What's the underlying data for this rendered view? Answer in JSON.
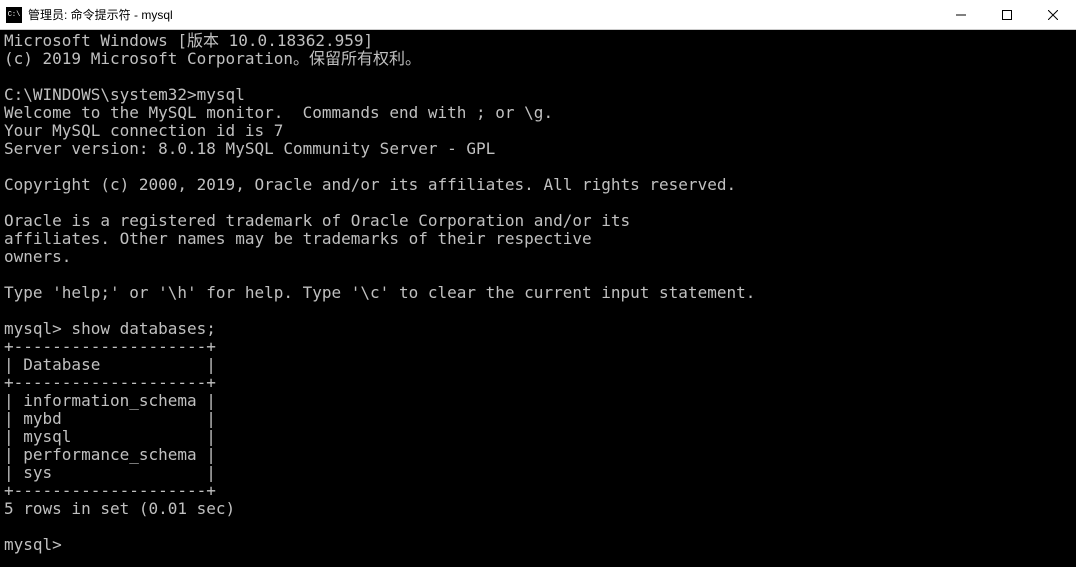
{
  "window": {
    "title": "管理员: 命令提示符 - mysql"
  },
  "terminal": {
    "lines": [
      "Microsoft Windows [版本 10.0.18362.959]",
      "(c) 2019 Microsoft Corporation。保留所有权利。",
      "",
      "C:\\WINDOWS\\system32>mysql",
      "Welcome to the MySQL monitor.  Commands end with ; or \\g.",
      "Your MySQL connection id is 7",
      "Server version: 8.0.18 MySQL Community Server - GPL",
      "",
      "Copyright (c) 2000, 2019, Oracle and/or its affiliates. All rights reserved.",
      "",
      "Oracle is a registered trademark of Oracle Corporation and/or its",
      "affiliates. Other names may be trademarks of their respective",
      "owners.",
      "",
      "Type 'help;' or '\\h' for help. Type '\\c' to clear the current input statement.",
      "",
      "mysql> show databases;",
      "+--------------------+",
      "| Database           |",
      "+--------------------+",
      "| information_schema |",
      "| mybd               |",
      "| mysql              |",
      "| performance_schema |",
      "| sys                |",
      "+--------------------+",
      "5 rows in set (0.01 sec)",
      "",
      "mysql>"
    ]
  }
}
